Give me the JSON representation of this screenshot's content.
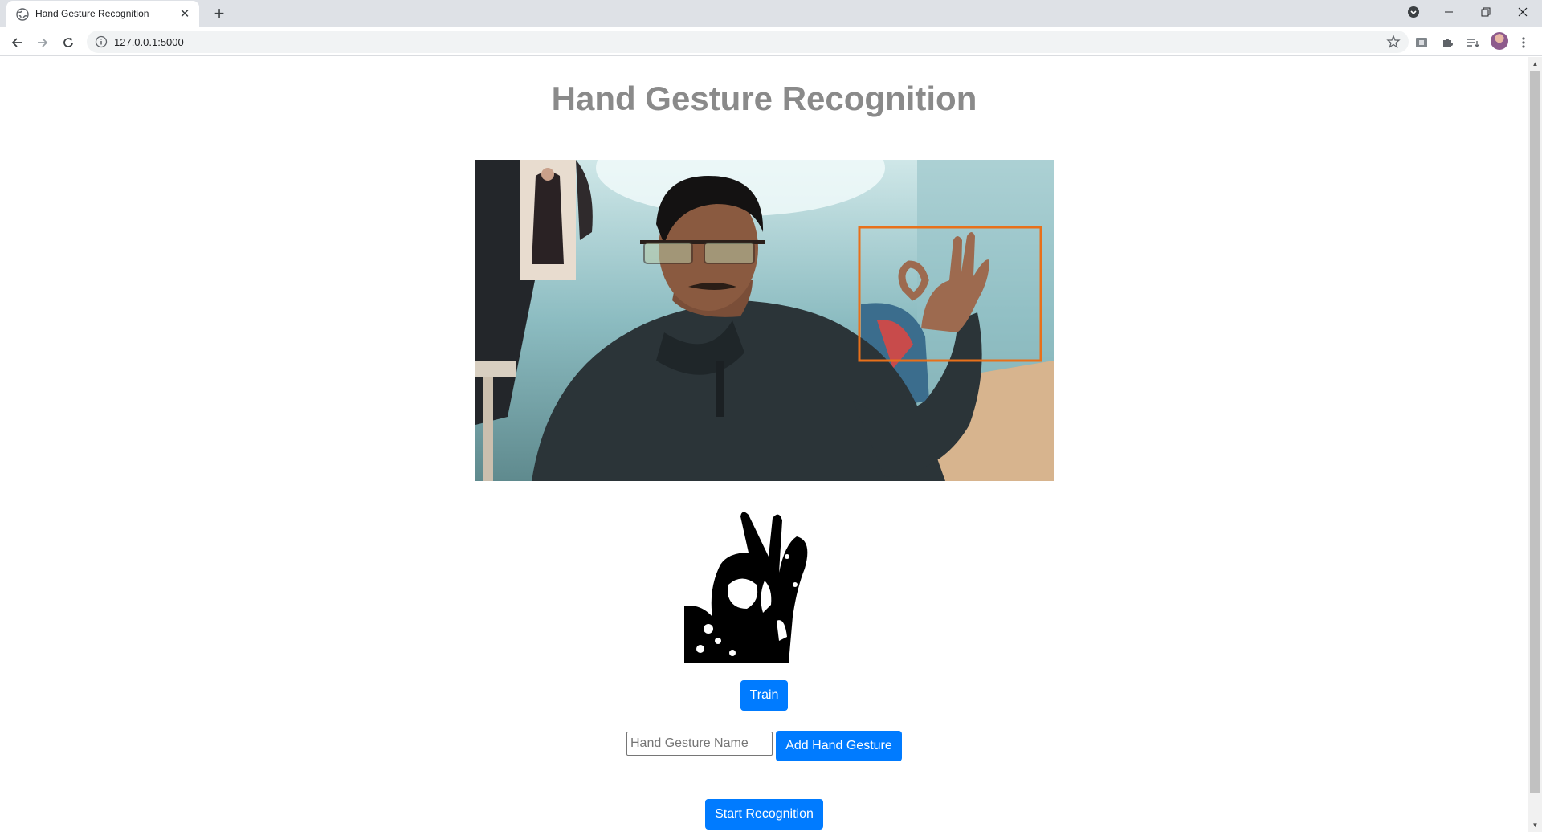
{
  "browser": {
    "tab_title": "Hand Gesture Recognition",
    "url": "127.0.0.1:5000",
    "icons": {
      "favicon": "globe-icon",
      "tab_close": "close-icon",
      "new_tab": "plus-icon",
      "back": "back-arrow-icon",
      "forward": "forward-arrow-icon",
      "reload": "reload-icon",
      "site_info": "info-icon",
      "bookmark": "star-icon",
      "media": "media-icon",
      "extensions": "puzzle-icon",
      "reading_list": "reading-list-icon",
      "menu": "kebab-menu-icon",
      "window_minimize": "minimize-icon",
      "window_restore": "restore-icon",
      "window_close": "close-icon",
      "tab_search": "tab-search-icon"
    }
  },
  "page": {
    "title": "Hand Gesture Recognition",
    "train_button": "Train",
    "gesture_name_placeholder": "Hand Gesture Name",
    "add_button": "Add Hand Gesture",
    "start_button": "Start Recognition",
    "roi_box_color": "#e8701a",
    "button_color": "#007bff"
  }
}
